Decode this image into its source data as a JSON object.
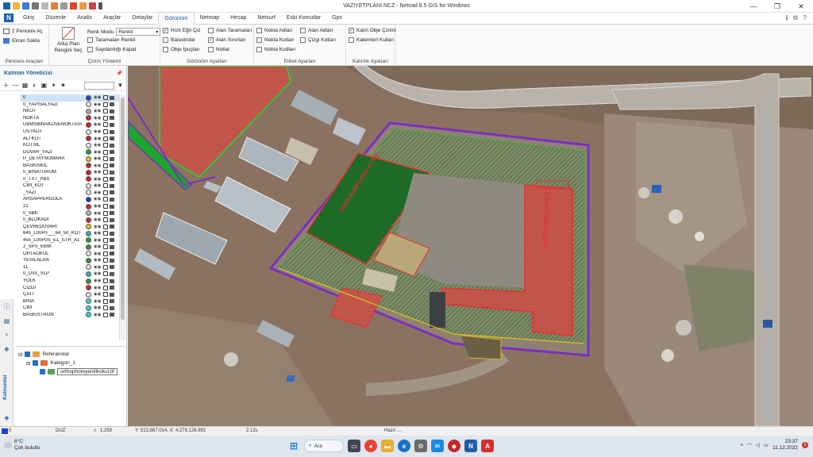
{
  "window": {
    "title": "VAZIYETPLANI.NCZ - Netcad 8.5 GIS for Windows",
    "controls": [
      "—",
      "❐",
      "✕"
    ]
  },
  "tabs": [
    {
      "label": "Giriş"
    },
    {
      "label": "Düzenle"
    },
    {
      "label": "Analiz"
    },
    {
      "label": "Araçlar"
    },
    {
      "label": "Detaylar"
    },
    {
      "label": "Görünüm",
      "active": true
    },
    {
      "label": "Netmap"
    },
    {
      "label": "Hesap"
    },
    {
      "label": "Netsurf"
    },
    {
      "label": "Eski Komutlar"
    },
    {
      "label": "Gps"
    }
  ],
  "ribbon": {
    "pencere": {
      "item1": "2 Pencere Aç",
      "item2": "Ekran Sakla",
      "label": "Pencere Araçları"
    },
    "cizim": {
      "arka_plan": "Arka Plan Rengini Seç",
      "renk_modu_label": "Renk Modu",
      "renk_modu_value": "Renkli",
      "taramalar": "Taramaları Renkli",
      "saydamligi": "Saydamlığı Kapat",
      "label": "Çizim Yöntemi"
    },
    "gorunum": {
      "c1": "Hızlı Eğri Çiz",
      "c2": "Balastrolar",
      "c3": "Obje İpuçları",
      "c4": "Alan Taramaları",
      "c5": "Alan Sınırları",
      "c6": "Notlar",
      "label": "Görünüm Ayarları"
    },
    "etiket": {
      "c1": "Nokta Adları",
      "c2": "Nokta Kotları",
      "c3": "Nokta Kodları",
      "c4": "Alan Adları",
      "c5": "Çizgi Kotları",
      "label": "Etiket Ayarları"
    },
    "kalinlik": {
      "c1": "Kalın Obje Çizimi",
      "c2": "Kalemleri Kullan",
      "label": "Kalınlık Ayarları"
    }
  },
  "panel": {
    "title": "Katman Yöneticisi",
    "pin": "📌",
    "side_label": "Katmanlar",
    "layers": [
      {
        "name": "0",
        "color": "#1f3fd6",
        "selected": true
      },
      {
        "name": "0_YAPISALYAZI",
        "color": "#e8e8e8"
      },
      {
        "name": "NKOT",
        "color": "#a9b2bd"
      },
      {
        "name": "NOKTA",
        "color": "#d62020"
      },
      {
        "name": "UBMSBINAKOSENOKTASI",
        "color": "#d62020"
      },
      {
        "name": "USTKOT",
        "color": "#e8e8e8"
      },
      {
        "name": "ALTKOT",
        "color": "#d62020"
      },
      {
        "name": "KOTSIL",
        "color": "#e8e8e8"
      },
      {
        "name": "DUVAR_YAZI",
        "color": "#2f9a2f"
      },
      {
        "name": "P_DETAYNUMARA",
        "color": "#e3c21d"
      },
      {
        "name": "BASKISKIL",
        "color": "#d62020"
      },
      {
        "name": "0_BINATURUM",
        "color": "#d62020"
      },
      {
        "name": "0_TXT_PBX",
        "color": "#d62020"
      },
      {
        "name": "CİM_KOT",
        "color": "#e8e8e8"
      },
      {
        "name": "_YAZI",
        "color": "#e8e8e8"
      },
      {
        "name": "AHSAPPERGOLA",
        "color": "#1f3fd6"
      },
      {
        "name": "21",
        "color": "#d62020"
      },
      {
        "name": "0_SBK",
        "color": "#a9b2bd"
      },
      {
        "name": "0_BLOKADI",
        "color": "#d62020"
      },
      {
        "name": "ÇEVREDUVARI",
        "color": "#e3c21d"
      },
      {
        "name": "645_L00P0___64_50_KOT",
        "color": "#2fb3b3"
      },
      {
        "name": "455_L00P0S_E1_STR_A1",
        "color": "#2f9a2f"
      },
      {
        "name": "2_SPS_EBW",
        "color": "#2f9a2f"
      },
      {
        "name": "ORTAOKUL",
        "color": "#e8e8e8"
      },
      {
        "name": "YESILALAN",
        "color": "#2f9a2f"
      },
      {
        "name": "11",
        "color": "#e8e8e8"
      },
      {
        "name": "0_LNS_VLP",
        "color": "#2fb3b3"
      },
      {
        "name": "YOLK",
        "color": "#2f9a2f"
      },
      {
        "name": "CİZGİ",
        "color": "#d62020"
      },
      {
        "name": "ÇATI",
        "color": "#e8e8e8"
      },
      {
        "name": "BINA",
        "color": "#2fd6d6"
      },
      {
        "name": "CİM",
        "color": "#2fd6d6"
      },
      {
        "name": "BASKISTRON",
        "color": "#2fd6d6"
      }
    ],
    "tree": {
      "root": "Referanslar",
      "cat": "Kategori_1",
      "file": "orthophotoyeniilkokul.tif"
    }
  },
  "map": {
    "label1": "SPOR KOMPLEKSİ ALANI",
    "label2": "İLKÖĞRETİM OKULU"
  },
  "status": {
    "mode": "DUZ",
    "zoom": "1,259",
    "coords": "Y: 513,867.014, X: 4,278,126.891",
    "time": "2.12s",
    "state": "Hazır ..."
  },
  "taskbar": {
    "temp": "6°C",
    "weather": "Çok bulutlu",
    "search": "Ara",
    "time": "23:37",
    "date": "11.12.2022",
    "notif": "2"
  }
}
